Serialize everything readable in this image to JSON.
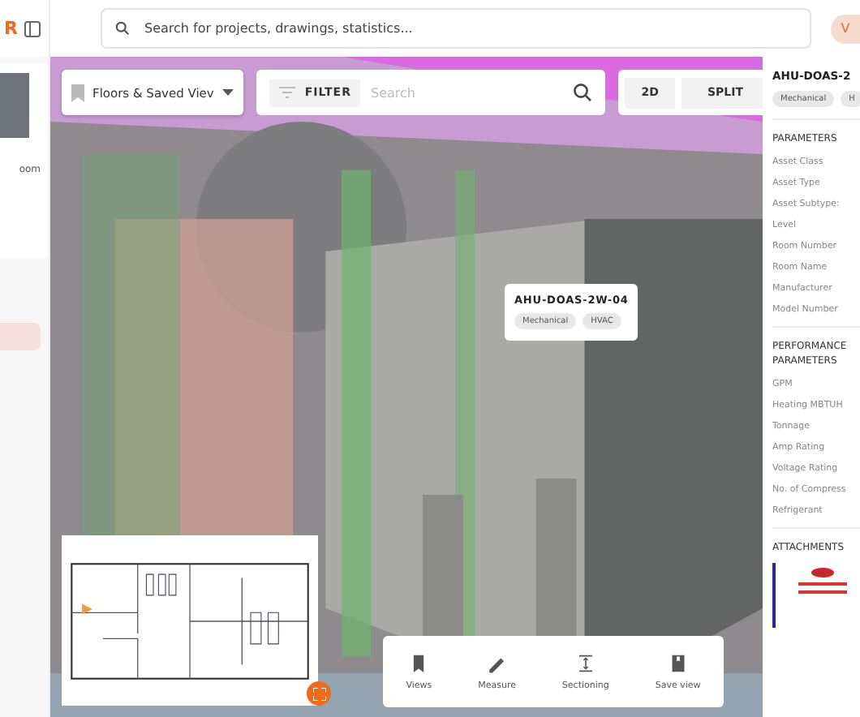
{
  "sidebar": {
    "logo": "R",
    "items": [
      {
        "kind": "photo"
      },
      {
        "kind": "text",
        "text": "oom"
      }
    ],
    "highlighted_item": {
      "selected": true
    }
  },
  "topbar": {
    "search": {
      "placeholder": "Search for projects, drawings, statistics..."
    },
    "avatar": "V"
  },
  "viewer": {
    "views_dropdown": "Floors & Saved Viev",
    "filter_button": "FILTER",
    "search": {
      "placeholder": "Search"
    },
    "mode_buttons": [
      {
        "label": "2D",
        "selected": false
      },
      {
        "label": "SPLIT",
        "selected": false
      }
    ],
    "tooltip": {
      "title": "AHU-DOAS-2W-04",
      "tags": [
        "Mechanical",
        "HVAC"
      ]
    },
    "toolbar": [
      {
        "kind": "views",
        "label": "Views"
      },
      {
        "kind": "measure",
        "label": "Measure"
      },
      {
        "kind": "sectioning",
        "label": "Sectioning"
      },
      {
        "kind": "save",
        "label": "Save view"
      }
    ]
  },
  "details": {
    "title": "AHU-DOAS-2",
    "tags": [
      "Mechanical",
      "H"
    ],
    "sections": [
      {
        "heading": "PARAMETERS",
        "rows": [
          "Asset Class",
          "Asset Type",
          "Asset Subtype:",
          "Level",
          "Room Number",
          "Room Name",
          "Manufacturer",
          "Model Number"
        ]
      },
      {
        "heading": "PERFORMANCE PARAMETERS",
        "rows": [
          "GPM",
          "Heating MBTUH",
          "Tonnage",
          "Amp Rating",
          "Voltage Rating",
          "No. of Compress",
          "Refrigerant"
        ]
      },
      {
        "heading": "ATTACHMENTS"
      }
    ]
  }
}
